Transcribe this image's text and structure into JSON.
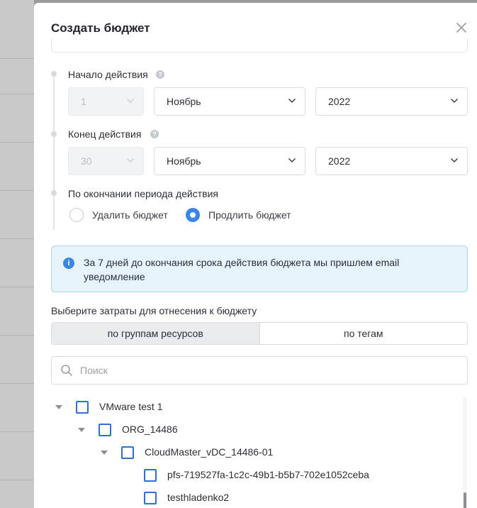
{
  "modal": {
    "title": "Создать бюджет"
  },
  "start": {
    "label": "Начало действия",
    "day": "1",
    "month": "Ноябрь",
    "year": "2022"
  },
  "end": {
    "label": "Конец действия",
    "day": "30",
    "month": "Ноябрь",
    "year": "2022"
  },
  "after": {
    "label": "По окончании периода действия",
    "option_delete": "Удалить бюджет",
    "option_extend": "Продлить бюджет",
    "selected": "option_extend"
  },
  "info": {
    "text": "За 7 дней до окончания срока действия бюджета мы пришлем email уведомление"
  },
  "costs": {
    "label": "Выберите затраты для отнесения к бюджету",
    "tab_groups": "по группам ресурсов",
    "tab_tags": "по тегам",
    "active_tab": "tab_groups"
  },
  "search": {
    "placeholder": "Поиск"
  },
  "tree": [
    {
      "label": "VMware test 1",
      "level": 0,
      "expanded": true
    },
    {
      "label": "ORG_14486",
      "level": 1,
      "expanded": true
    },
    {
      "label": "CloudMaster_vDC_14486-01",
      "level": 2,
      "expanded": true
    },
    {
      "label": "pfs-719527fa-1c2c-49b1-b5b7-702e1052ceba",
      "level": 3,
      "expanded": false
    },
    {
      "label": "testhladenko2",
      "level": 3,
      "expanded": false
    }
  ],
  "colors": {
    "accent": "#3a86e6",
    "info_bg": "#e6f3fb",
    "info_border": "#a9d5ee"
  }
}
